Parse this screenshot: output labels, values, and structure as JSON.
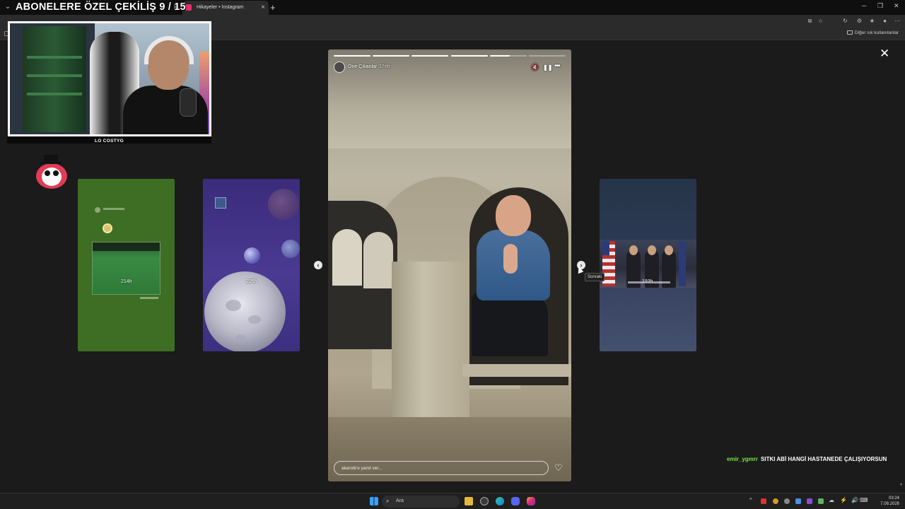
{
  "overlay": {
    "title": "ABONELERE ÖZEL ÇEKİLİŞ 9 / 15",
    "cam_logo": "LO COSTYG"
  },
  "browser": {
    "tabs": [
      {
        "label": "",
        "active": false
      },
      {
        "label": "Hikayeler • Instagram",
        "active": true
      }
    ],
    "new_tab": "+",
    "window_controls": [
      "─",
      "❐",
      "✕"
    ],
    "bookmarks": {
      "other_label": "Diğer sık kullanılanlar"
    },
    "accent": "#e1306c"
  },
  "viewer": {
    "close_icon": "✕",
    "side_stories": [
      {
        "age": "214h"
      },
      {
        "age": "226h"
      },
      {
        "age": "193h"
      }
    ],
    "prev_arrow": "‹",
    "next_arrow": "›",
    "next_tooltip": "Sonraki",
    "main_story": {
      "user": "Öne Çıkanlar",
      "time": "17éh",
      "progress": [
        1,
        1,
        1,
        1,
        0.55,
        0
      ],
      "mute_icon": "🔇",
      "pause_icon": "❚❚",
      "more_icon": "•••",
      "reply_placeholder": "akarstk'e yanıt ver...",
      "heart_icon": "♡"
    }
  },
  "chat": {
    "user": "emir_ygmrr",
    "message": "SITKI ABİ HANGİ HASTANEDE ÇALIŞIYORSUN"
  },
  "taskbar": {
    "search_placeholder": "Ara",
    "search_icon": "⌕",
    "time": "03:24",
    "date": "7.08.2026",
    "tray_icons": [
      "^",
      "☁",
      "⚡",
      "🔊",
      "⌨"
    ]
  }
}
